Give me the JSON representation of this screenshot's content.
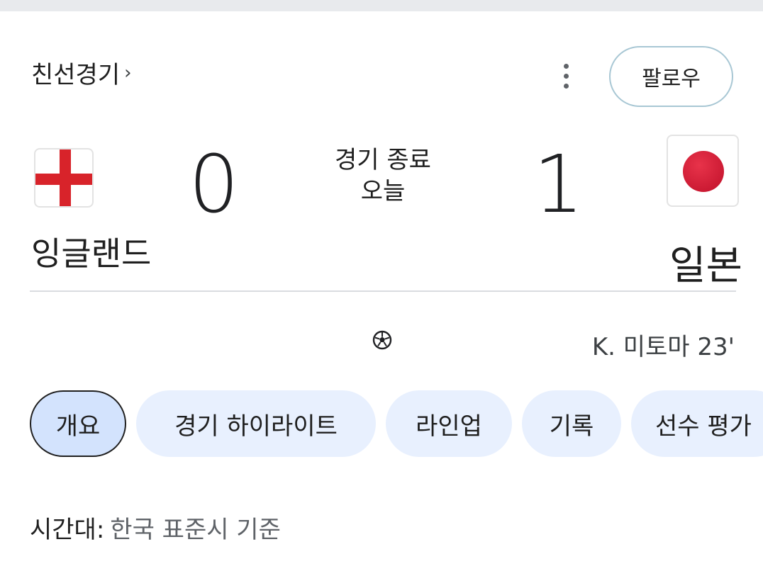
{
  "header": {
    "competition": "친선경기",
    "chevron": "›",
    "more_icon": "more-vert-icon",
    "follow_label": "팔로우"
  },
  "match": {
    "home": {
      "name": "잉글랜드",
      "score": "0",
      "flag_icon": "england-flag-icon"
    },
    "away": {
      "name": "일본",
      "score": "1",
      "flag_icon": "japan-flag-icon"
    },
    "status": "경기 종료",
    "date": "오늘"
  },
  "events": [
    {
      "icon": "soccer-ball-icon",
      "text": "K. 미토마 23'"
    }
  ],
  "tabs": [
    {
      "label": "개요",
      "active": true
    },
    {
      "label": "경기 하이라이트",
      "active": false
    },
    {
      "label": "라인업",
      "active": false
    },
    {
      "label": "기록",
      "active": false
    },
    {
      "label": "선수 평가",
      "active": false
    }
  ],
  "timezone": {
    "label": "시간대:",
    "value": "한국 표준시 기준"
  },
  "colors": {
    "chip_bg": "#e8f0fe",
    "chip_active_bg": "#d3e3fd",
    "england_red": "#d8232a",
    "japan_red": "#c0102a"
  }
}
